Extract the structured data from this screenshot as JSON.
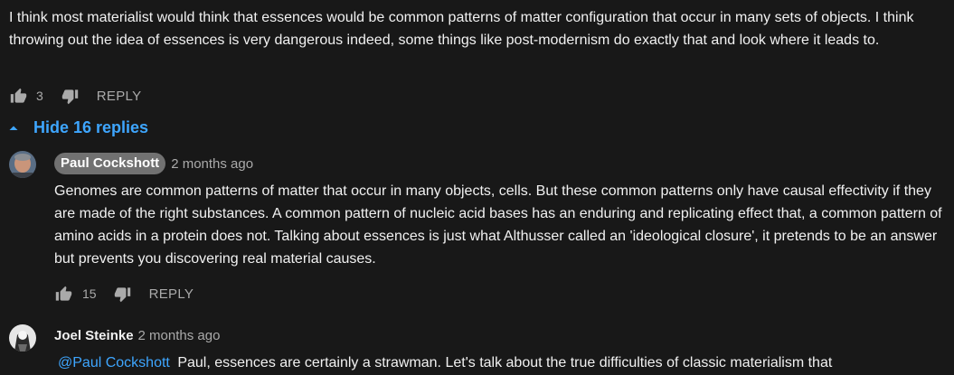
{
  "top_comment": {
    "text": "I think most materialist would think that essences would be common patterns of matter configuration that occur in many sets of objects. I think throwing out the idea of essences is very dangerous indeed, some things like post-modernism do exactly that and look where it leads to.",
    "likes": "3",
    "reply_label": "REPLY"
  },
  "replies_toggle": {
    "label": "Hide 16 replies",
    "icon": "chevron-up-icon"
  },
  "replies": [
    {
      "author": "Paul Cockshott",
      "timestamp": "2 months ago",
      "text": "Genomes are common patterns of matter that occur in many objects, cells. But these common patterns only have causal effectivity if they are made of the right substances. A common pattern of nucleic acid bases has an enduring and replicating effect that, a common pattern of amino acids in a protein does not. Talking about essences is just what Althusser called an 'ideological closure', it pretends to be an answer but prevents you discovering real material causes.",
      "likes": "15",
      "reply_label": "REPLY"
    },
    {
      "author": "Joel Steinke",
      "timestamp": "2 months ago",
      "mention": "@Paul Cockshott",
      "text": "Paul, essences are certainly a strawman. Let's talk about the true difficulties of classic materialism that"
    }
  ],
  "colors": {
    "background": "#181818",
    "text": "#f1f1f1",
    "muted": "#aaaaaa",
    "link": "#3ea6ff",
    "author_chip": "#717171"
  }
}
